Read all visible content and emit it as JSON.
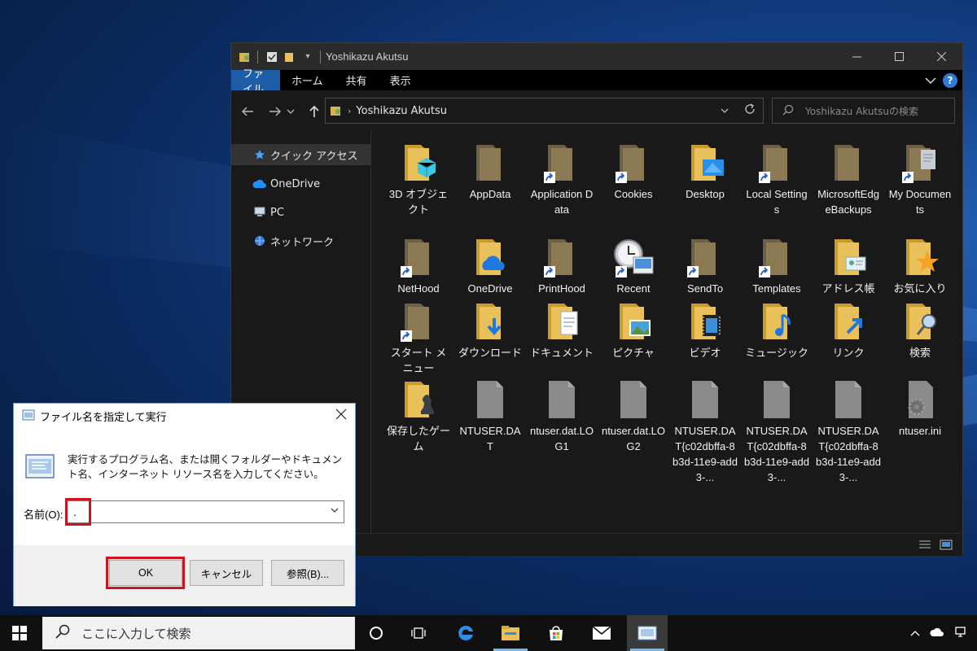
{
  "explorer": {
    "title": "Yoshikazu Akutsu",
    "ribbon_tabs": [
      "ファイル",
      "ホーム",
      "共有",
      "表示"
    ],
    "help": "?",
    "address": "Yoshikazu Akutsu",
    "search_placeholder": "Yoshikazu Akutsuの検索",
    "nav": [
      "クイック アクセス",
      "OneDrive",
      "PC",
      "ネットワーク"
    ],
    "files": [
      {
        "name": "3D オブジェクト",
        "icon": "folder-3d",
        "shortcut": false
      },
      {
        "name": "AppData",
        "icon": "folder-dim",
        "shortcut": false
      },
      {
        "name": "Application Data",
        "icon": "folder-dim",
        "shortcut": true
      },
      {
        "name": "Cookies",
        "icon": "folder-dim",
        "shortcut": true
      },
      {
        "name": "Desktop",
        "icon": "folder-desktop",
        "shortcut": false
      },
      {
        "name": "Local Settings",
        "icon": "folder-dim",
        "shortcut": true
      },
      {
        "name": "MicrosoftEdgeBackups",
        "icon": "folder-dim",
        "shortcut": false
      },
      {
        "name": "My Documents",
        "icon": "folder-doc-dim",
        "shortcut": true
      },
      {
        "name": "NetHood",
        "icon": "folder-dim",
        "shortcut": true
      },
      {
        "name": "OneDrive",
        "icon": "folder-onedrive",
        "shortcut": false
      },
      {
        "name": "PrintHood",
        "icon": "folder-dim",
        "shortcut": true
      },
      {
        "name": "Recent",
        "icon": "recent",
        "shortcut": true
      },
      {
        "name": "SendTo",
        "icon": "folder-dim",
        "shortcut": true
      },
      {
        "name": "Templates",
        "icon": "folder-dim",
        "shortcut": true
      },
      {
        "name": "アドレス帳",
        "icon": "folder-contacts",
        "shortcut": false
      },
      {
        "name": "お気に入り",
        "icon": "folder-star",
        "shortcut": false
      },
      {
        "name": "スタート メニュー",
        "icon": "folder-dim",
        "shortcut": true
      },
      {
        "name": "ダウンロード",
        "icon": "folder-download",
        "shortcut": false
      },
      {
        "name": "ドキュメント",
        "icon": "folder-doc",
        "shortcut": false
      },
      {
        "name": "ピクチャ",
        "icon": "folder-picture",
        "shortcut": false
      },
      {
        "name": "ビデオ",
        "icon": "folder-video",
        "shortcut": false
      },
      {
        "name": "ミュージック",
        "icon": "folder-music",
        "shortcut": false
      },
      {
        "name": "リンク",
        "icon": "folder-link",
        "shortcut": false
      },
      {
        "name": "検索",
        "icon": "folder-search",
        "shortcut": false
      },
      {
        "name": "保存したゲーム",
        "icon": "folder-games",
        "shortcut": false
      },
      {
        "name": "NTUSER.DAT",
        "icon": "file",
        "shortcut": false
      },
      {
        "name": "ntuser.dat.LOG1",
        "icon": "file",
        "shortcut": false
      },
      {
        "name": "ntuser.dat.LOG2",
        "icon": "file",
        "shortcut": false
      },
      {
        "name": "NTUSER.DAT{c02dbffa-8b3d-11e9-add3-...",
        "icon": "file",
        "shortcut": false
      },
      {
        "name": "NTUSER.DAT{c02dbffa-8b3d-11e9-add3-...",
        "icon": "file",
        "shortcut": false
      },
      {
        "name": "NTUSER.DAT{c02dbffa-8b3d-11e9-add3-...",
        "icon": "file",
        "shortcut": false
      },
      {
        "name": "ntuser.ini",
        "icon": "file-gear",
        "shortcut": false
      }
    ]
  },
  "run_dialog": {
    "title": "ファイル名を指定して実行",
    "description": "実行するプログラム名、または開くフォルダーやドキュメント名、インターネット リソース名を入力してください。",
    "name_label": "名前(O):",
    "input_value": ".",
    "ok_label": "OK",
    "cancel_label": "キャンセル",
    "browse_label": "参照(B)..."
  },
  "taskbar": {
    "search_placeholder": "ここに入力して検索"
  },
  "colors": {
    "highlight": "#d0141d",
    "accent": "#1e5ea8",
    "folder": "#e8c15a",
    "folder_dim": "#8c7a55"
  }
}
